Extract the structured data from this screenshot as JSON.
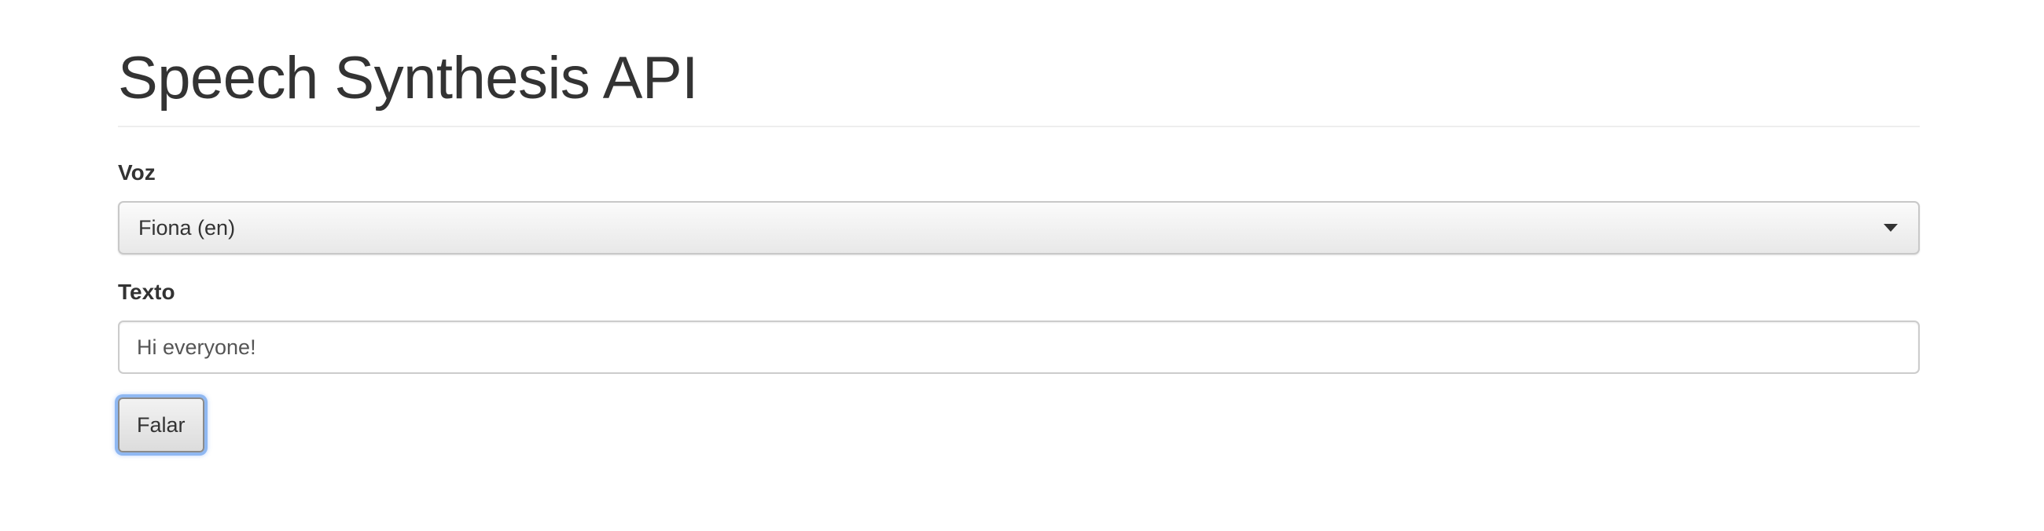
{
  "page": {
    "title": "Speech Synthesis API"
  },
  "form": {
    "voice_label": "Voz",
    "voice_selected": "Fiona (en)",
    "text_label": "Texto",
    "text_value": "Hi everyone!",
    "speak_button_label": "Falar"
  },
  "colors": {
    "text": "#333333",
    "focus_ring": "#8fb8f2",
    "border": "#cccccc"
  }
}
